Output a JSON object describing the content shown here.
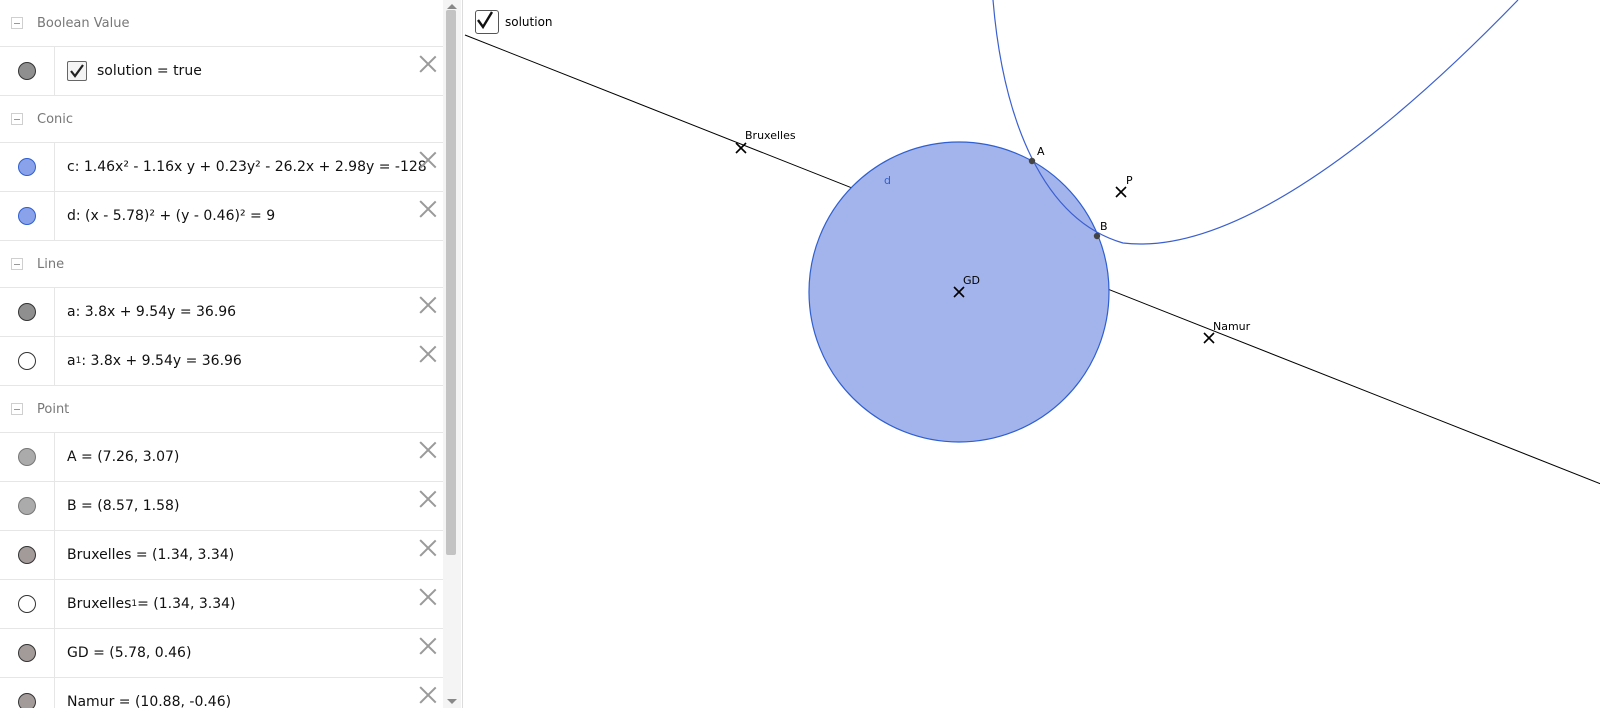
{
  "colors": {
    "circle_fill": "#a3b4ec",
    "circle_stroke": "#2f5fd0",
    "conic_stroke": "#3a5fd0",
    "line_stroke": "#000000",
    "marble_gray": "#8f8f8f",
    "marble_light": "#ababab",
    "marble_brown": "#a39a9a",
    "marble_blue": "#8aa2ea"
  },
  "algebra": {
    "groups": [
      {
        "name": "Boolean Value",
        "rows": [
          {
            "label": "solution = true",
            "checkbox": true,
            "marble": "#8f8f8f"
          }
        ]
      },
      {
        "name": "Conic",
        "rows": [
          {
            "label": "c: 1.46x² - 1.16x y + 0.23y² - 26.2x + 2.98y = -128",
            "marble": "#8aa2ea"
          },
          {
            "label": "d: (x - 5.78)² + (y - 0.46)² = 9",
            "marble": "#8aa2ea"
          }
        ]
      },
      {
        "name": "Line",
        "rows": [
          {
            "label": "a: 3.8x + 9.54y = 36.96",
            "marble": "#8f8f8f"
          },
          {
            "label_main": "a",
            "label_sub": "1",
            "label_rest": ": 3.8x + 9.54y = 36.96",
            "marble": "#ffffff"
          }
        ]
      },
      {
        "name": "Point",
        "rows": [
          {
            "label": "A = (7.26, 3.07)",
            "marble": "#ababab"
          },
          {
            "label": "B = (8.57, 1.58)",
            "marble": "#ababab"
          },
          {
            "label": "Bruxelles = (1.34, 3.34)",
            "marble": "#a39a9a"
          },
          {
            "label_main": "Bruxelles",
            "label_sub": "1",
            "label_rest": " = (1.34, 3.34)",
            "marble": "#ffffff"
          },
          {
            "label": "GD = (5.78, 0.46)",
            "marble": "#a39a9a"
          },
          {
            "label": "Namur = (10.88, -0.46)",
            "marble": "#a39a9a"
          }
        ]
      }
    ]
  },
  "graphics": {
    "checkbox_label": "solution",
    "labels": {
      "bruxelles": "Bruxelles",
      "namur": "Namur",
      "gd": "GD",
      "a": "A",
      "b": "B",
      "p": "P",
      "d": "d"
    }
  }
}
